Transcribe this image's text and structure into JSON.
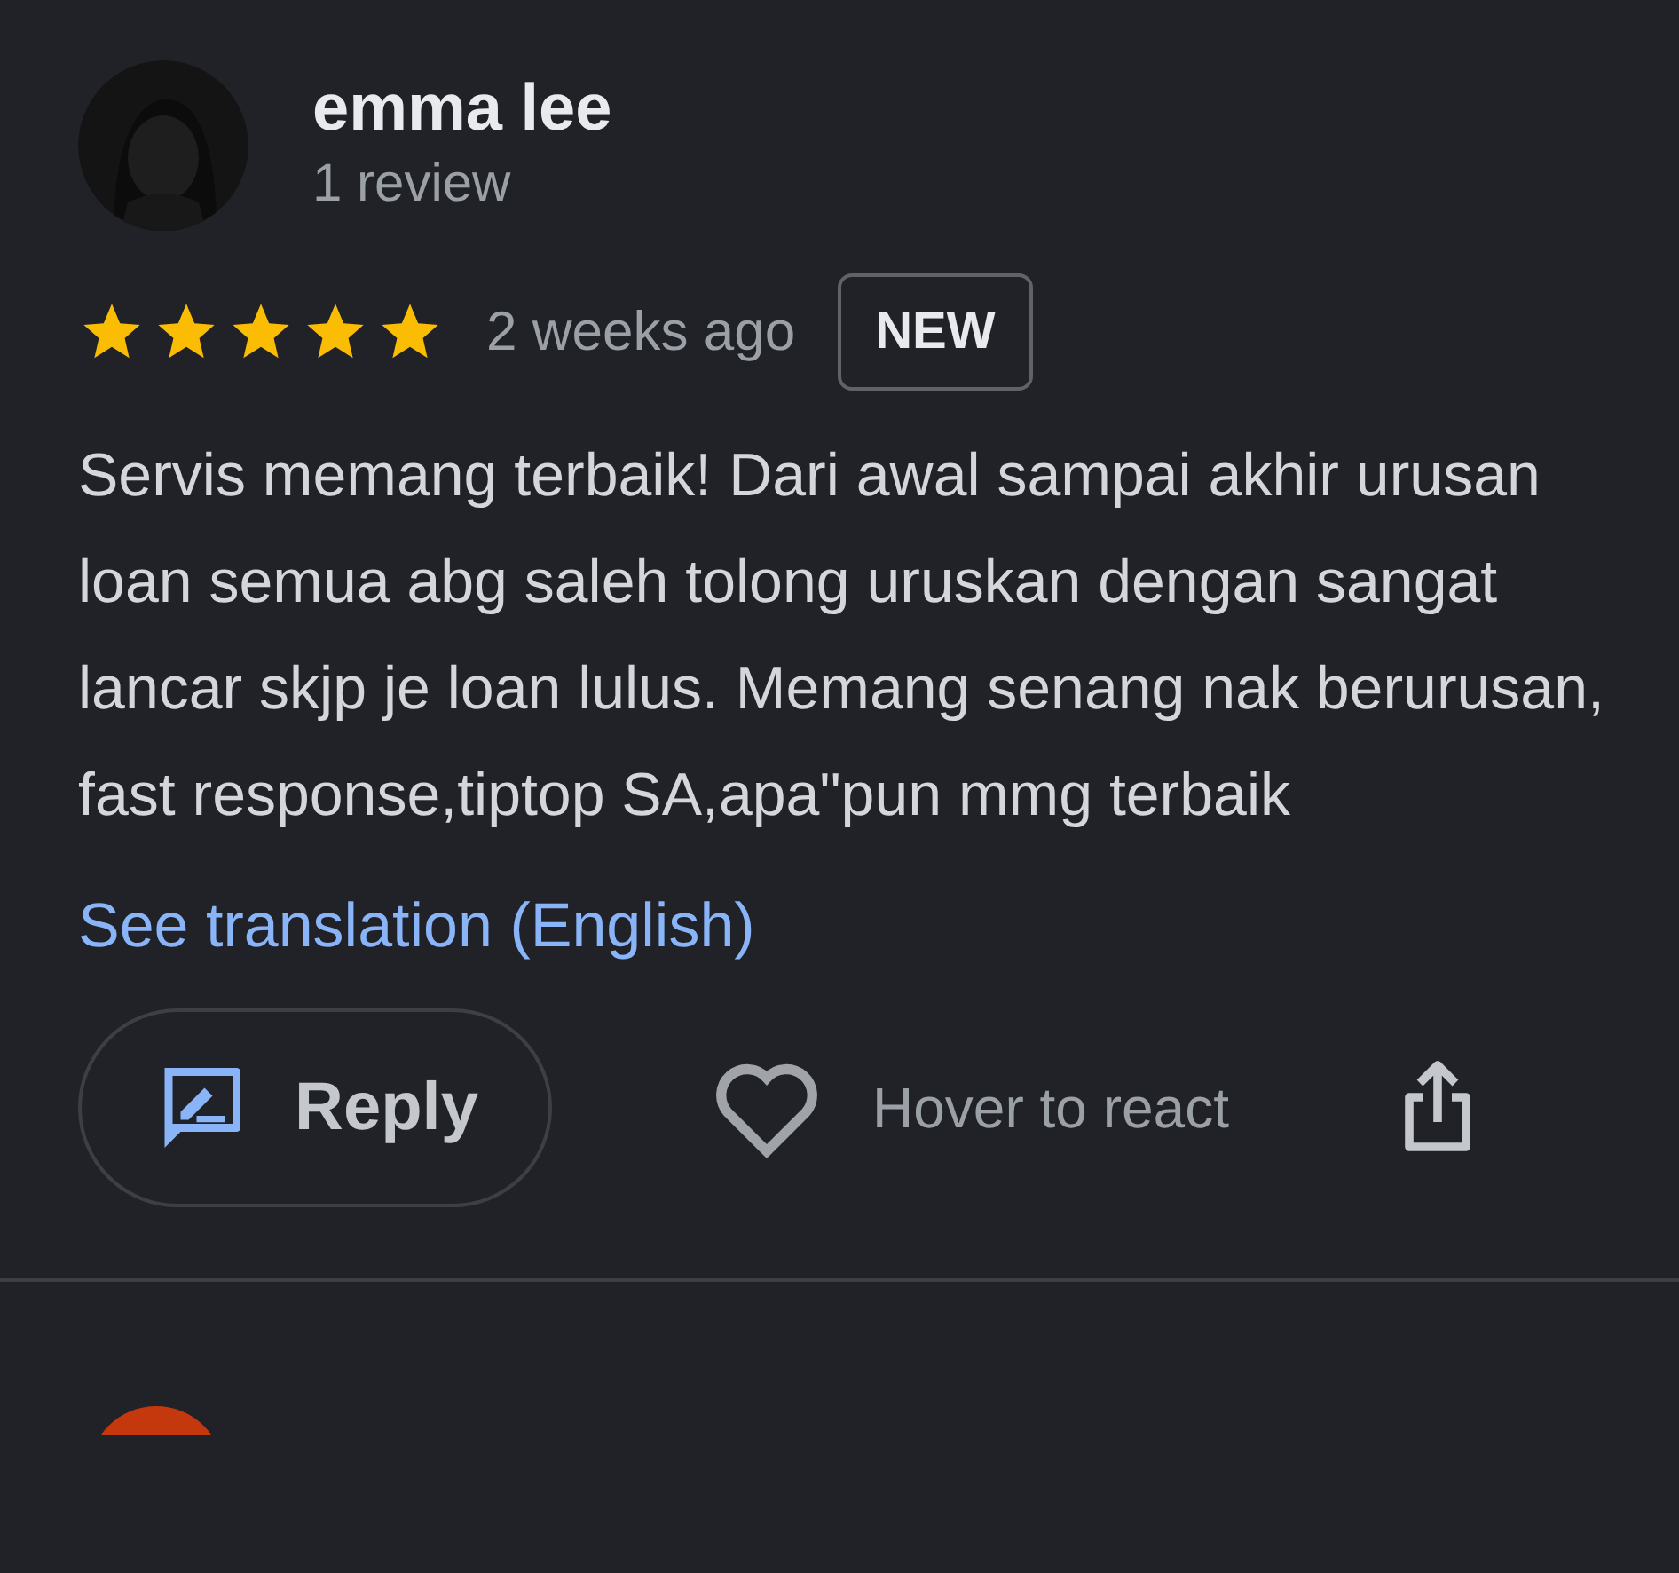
{
  "review": {
    "author": "emma lee",
    "review_count": "1 review",
    "stars": 5,
    "time": "2 weeks ago",
    "badge": "NEW",
    "text": "Servis memang terbaik! Dari awal sampai akhir urusan loan semua abg saleh tolong uruskan dengan sangat lancar skjp je loan lulus. Memang senang nak berurusan, fast response,tiptop SA,apa\"pun mmg terbaik",
    "translation_link": "See translation (English)",
    "reply_button": "Reply",
    "react_label": "Hover to react"
  }
}
